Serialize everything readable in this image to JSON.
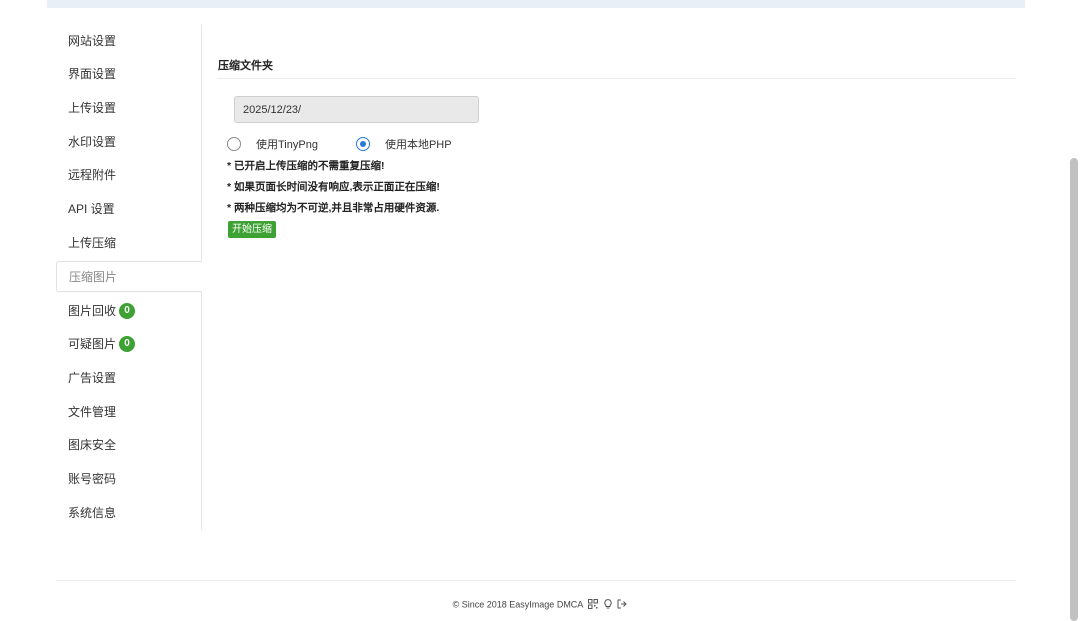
{
  "sidebar": {
    "items": [
      {
        "label": "网站设置"
      },
      {
        "label": "界面设置"
      },
      {
        "label": "上传设置"
      },
      {
        "label": "水印设置"
      },
      {
        "label": "远程附件"
      },
      {
        "label": "API 设置"
      },
      {
        "label": "上传压缩"
      },
      {
        "label": "压缩图片",
        "active": true
      },
      {
        "label": "图片回收",
        "badge": "0"
      },
      {
        "label": "可疑图片",
        "badge": "0"
      },
      {
        "label": "广告设置"
      },
      {
        "label": "文件管理"
      },
      {
        "label": "图床安全"
      },
      {
        "label": "账号密码"
      },
      {
        "label": "系统信息"
      }
    ]
  },
  "panel": {
    "title": "压缩文件夹",
    "path_value": "2025/12/23/",
    "options": [
      {
        "label": "使用TinyPng",
        "checked": false
      },
      {
        "label": "使用本地PHP",
        "checked": true
      }
    ],
    "notes": [
      "* 已开启上传压缩的不需重复压缩!",
      "* 如果页面长时间没有响应,表示正面正在压缩!",
      "* 两种压缩均为不可逆,并且非常占用硬件资源."
    ],
    "start_button": "开始压缩"
  },
  "footer": {
    "text": "© Since 2018 EasyImage DMCA",
    "icons": [
      "qrcode-icon",
      "lightbulb-icon",
      "logout-icon"
    ]
  },
  "colors": {
    "accent_green": "#3da233",
    "radio_blue": "#2b78d6"
  }
}
